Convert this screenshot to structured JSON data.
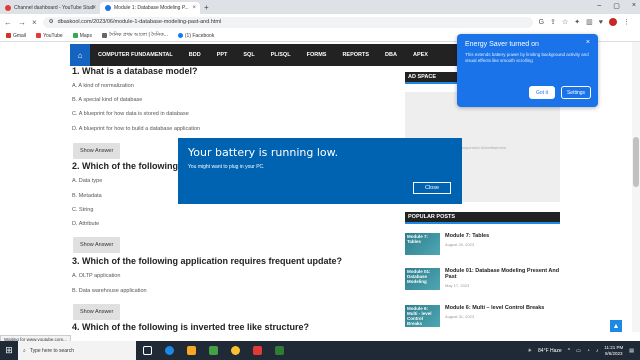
{
  "browser": {
    "tabs": [
      {
        "label": "Channel dashboard - YouTube Studi"
      },
      {
        "label": "Module 1: Database Modeling P..."
      }
    ],
    "url": "dbaskool.com/2023/06/module-1-database-modeling-past-and.html",
    "bookmarks": [
      "Gmail",
      "YouTube",
      "Maps",
      "দৈনিক প্রথম আলো | দৈনিক...",
      "(1) Facebook"
    ]
  },
  "sitenav": {
    "items": [
      "COMPUTER FUNDAMENTAL",
      "BDD",
      "PPT",
      "SQL",
      "PL/SQL",
      "FORMS",
      "REPORTS",
      "DBA",
      "APEX"
    ]
  },
  "questions": [
    {
      "title": "1. What is a database model?",
      "options": [
        "A. A kind of normalization",
        "B. A special kind of database",
        "C. A blueprint for how data is stored in database",
        "D. A blueprint for how to build a database application"
      ]
    },
    {
      "title": "2. Which of the following",
      "options": [
        "A. Data type",
        "B. Metadata",
        "C. String",
        "D. Attribute"
      ]
    },
    {
      "title": "3.  Which of the following application requires frequent update?",
      "options": [
        "A. OLTP application",
        "B. Data warehouse application"
      ]
    },
    {
      "title": "4. Which of the following is inverted tree like structure?",
      "options": []
    }
  ],
  "show_answer_label": "Show Answer",
  "sidebar": {
    "ad_space": "AD SPACE",
    "ad_placeholder": "Responsive Advertisement",
    "popular_posts": "POPULAR POSTS",
    "posts": [
      {
        "thumb": "Module 7: Tables",
        "title": "Module 7: Tables",
        "date": "August 20, 2023"
      },
      {
        "thumb": "Module 01: Database Modeling",
        "title": "Module 01: Database Modeling Present And Past",
        "date": "May 17, 2023"
      },
      {
        "thumb": "Module 6: Multi - level Control Breaks",
        "title": "Module 6: Multi – level Control Breaks",
        "date": "August 31, 2023"
      }
    ]
  },
  "battery_dialog": {
    "title": "Your battery is running low.",
    "message": "You might want to plug in your PC.",
    "close": "Close"
  },
  "energy_saver": {
    "title": "Energy Saver turned on",
    "body": "This extends battery power by limiting background activity and visual effects like smooth scrolling",
    "got_it": "Got it",
    "settings": "Settings"
  },
  "status_url": "Waiting for www.youtube.com...",
  "taskbar": {
    "search_placeholder": "Type here to search",
    "weather": "84°F  Haze",
    "time": "11:21 PM",
    "date": "9/6/2023"
  }
}
